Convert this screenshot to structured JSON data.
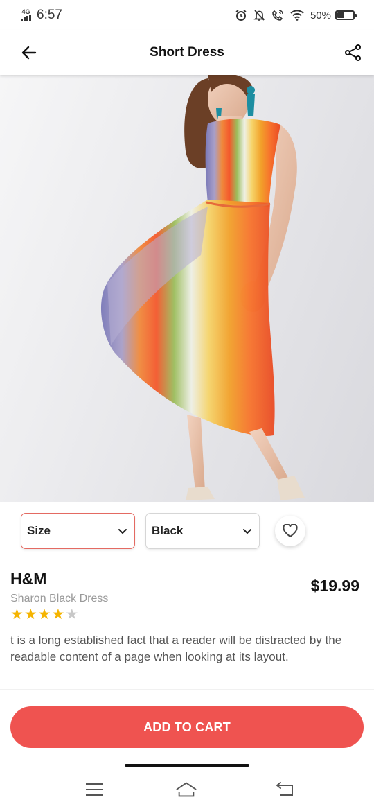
{
  "status_bar": {
    "network": "4G",
    "time": "6:57",
    "battery": "50%",
    "battery_level": 0.5
  },
  "app_bar": {
    "title": "Short Dress"
  },
  "selectors": {
    "size_label": "Size",
    "color_label": "Black"
  },
  "product": {
    "brand": "H&M",
    "name": "Sharon Black Dress",
    "price": "$19.99",
    "rating": 4,
    "rating_max": 5,
    "description": "t is a long established fact that a reader will be distracted by the readable content of a page when looking at its layout."
  },
  "actions": {
    "add_to_cart": "ADD TO CART"
  },
  "colors": {
    "accent": "#ef5350",
    "star_filled": "#f5b400",
    "star_empty": "#c8c8c8"
  }
}
